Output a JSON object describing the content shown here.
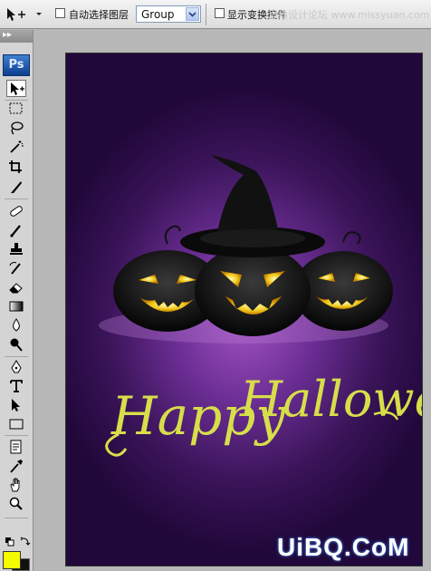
{
  "options_bar": {
    "auto_select_label": "自动选择图层",
    "auto_select_checked": false,
    "auto_select_value": "Group",
    "show_transform_label": "显示变换控件",
    "show_transform_checked": false,
    "watermark_top": "思缘设计论坛 www.missyuan.com"
  },
  "toolbox": {
    "grip": "▸▸",
    "logo": "Ps",
    "tools": [
      "move-tool",
      "marquee-tool",
      "lasso-tool",
      "magic-wand-tool",
      "crop-tool",
      "slice-tool",
      "healing-brush-tool",
      "brush-tool",
      "clone-stamp-tool",
      "history-brush-tool",
      "eraser-tool",
      "gradient-tool",
      "blur-tool",
      "dodge-tool",
      "pen-tool",
      "type-tool",
      "path-selection-tool",
      "shape-tool",
      "notes-tool",
      "eyedropper-tool",
      "hand-tool",
      "zoom-tool"
    ],
    "active_tool": "move-tool",
    "foreground_color": "#f5fc00",
    "background_color": "#111111"
  },
  "canvas": {
    "headline_word1": "Happy",
    "headline_word2": "Halloween",
    "text_color": "#d7de4a",
    "background_color": "#5a2682"
  },
  "watermark_bottom": "UiBQ.CoM"
}
